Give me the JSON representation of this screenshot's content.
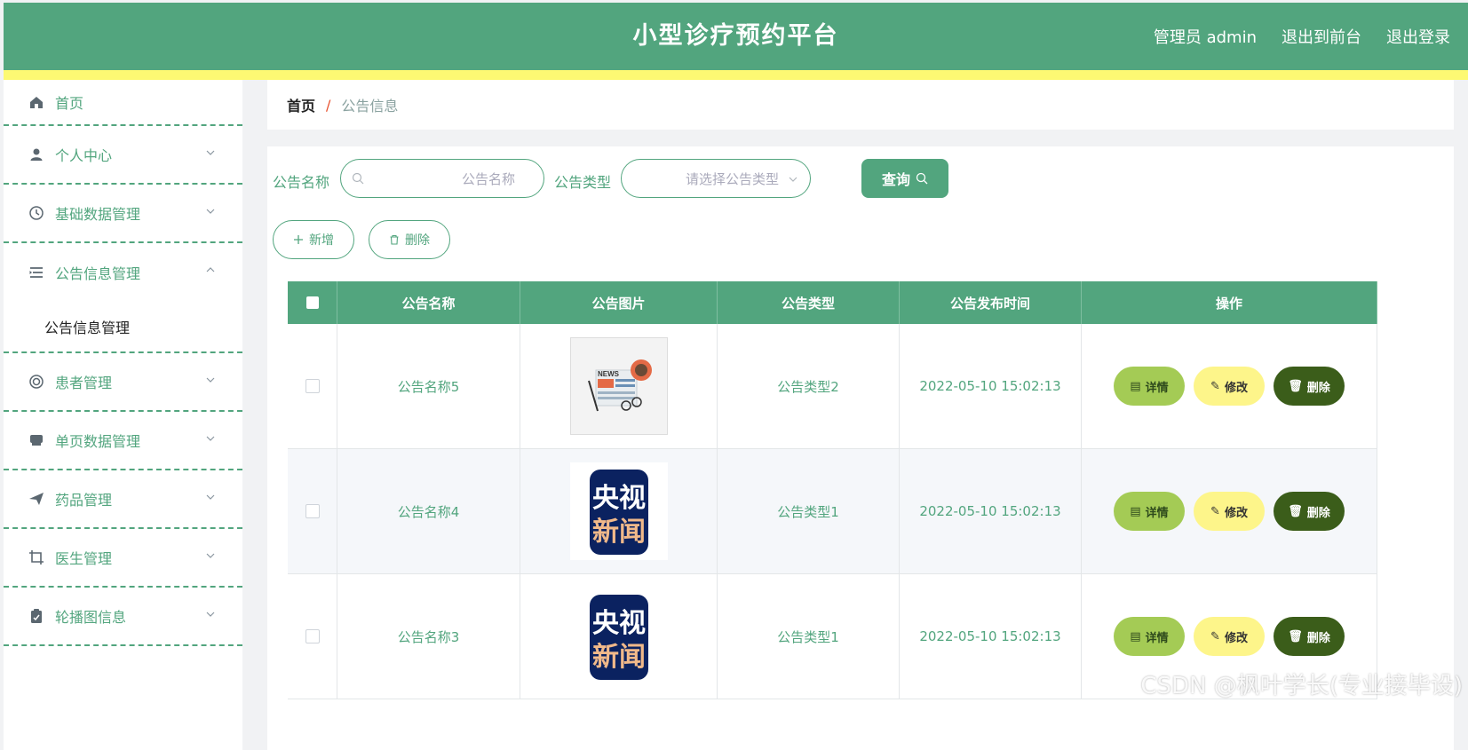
{
  "header": {
    "title": "小型诊疗预约平台",
    "admin_label": "管理员 admin",
    "front_link": "退出到前台",
    "logout_link": "退出登录"
  },
  "sidebar": {
    "items": [
      {
        "label": "首页",
        "icon": "home-icon"
      },
      {
        "label": "个人中心",
        "icon": "user-icon"
      },
      {
        "label": "基础数据管理",
        "icon": "clock-icon"
      },
      {
        "label": "公告信息管理",
        "icon": "list-icon",
        "expanded": true,
        "subitems": [
          "公告信息管理"
        ]
      },
      {
        "label": "患者管理",
        "icon": "lifebuoy-icon"
      },
      {
        "label": "单页数据管理",
        "icon": "printer-icon"
      },
      {
        "label": "药品管理",
        "icon": "send-icon"
      },
      {
        "label": "医生管理",
        "icon": "crop-icon"
      },
      {
        "label": "轮播图信息",
        "icon": "clipboard-icon"
      }
    ]
  },
  "breadcrumb": {
    "home": "首页",
    "sep": "/",
    "current": "公告信息"
  },
  "search": {
    "name_label": "公告名称",
    "name_placeholder": "公告名称",
    "type_label": "公告类型",
    "type_placeholder": "请选择公告类型",
    "query_button": "查询"
  },
  "actions": {
    "add": "新增",
    "delete": "删除"
  },
  "table": {
    "columns": [
      "公告名称",
      "公告图片",
      "公告类型",
      "公告发布时间",
      "操作"
    ],
    "rows": [
      {
        "name": "公告名称5",
        "image": "news-illustration",
        "type": "公告类型2",
        "time": "2022-05-10 15:02:13"
      },
      {
        "name": "公告名称4",
        "image": "cctv-news-logo",
        "type": "公告类型1",
        "time": "2022-05-10 15:02:13"
      },
      {
        "name": "公告名称3",
        "image": "cctv-news-logo",
        "type": "公告类型1",
        "time": "2022-05-10 15:02:13"
      }
    ],
    "row_actions": {
      "detail": "详情",
      "edit": "修改",
      "delete": "删除"
    }
  },
  "logo_text": {
    "news": "NEWS",
    "cctv_line1": "央视",
    "cctv_line2": "新闻"
  },
  "watermark": "CSDN @枫叶学长(专业接毕设)",
  "colors": {
    "primary": "#52a57e",
    "stripe": "#fdf973",
    "detail": "#a4cb55",
    "edit": "#fdf58a",
    "delete": "#3b5d1a"
  }
}
